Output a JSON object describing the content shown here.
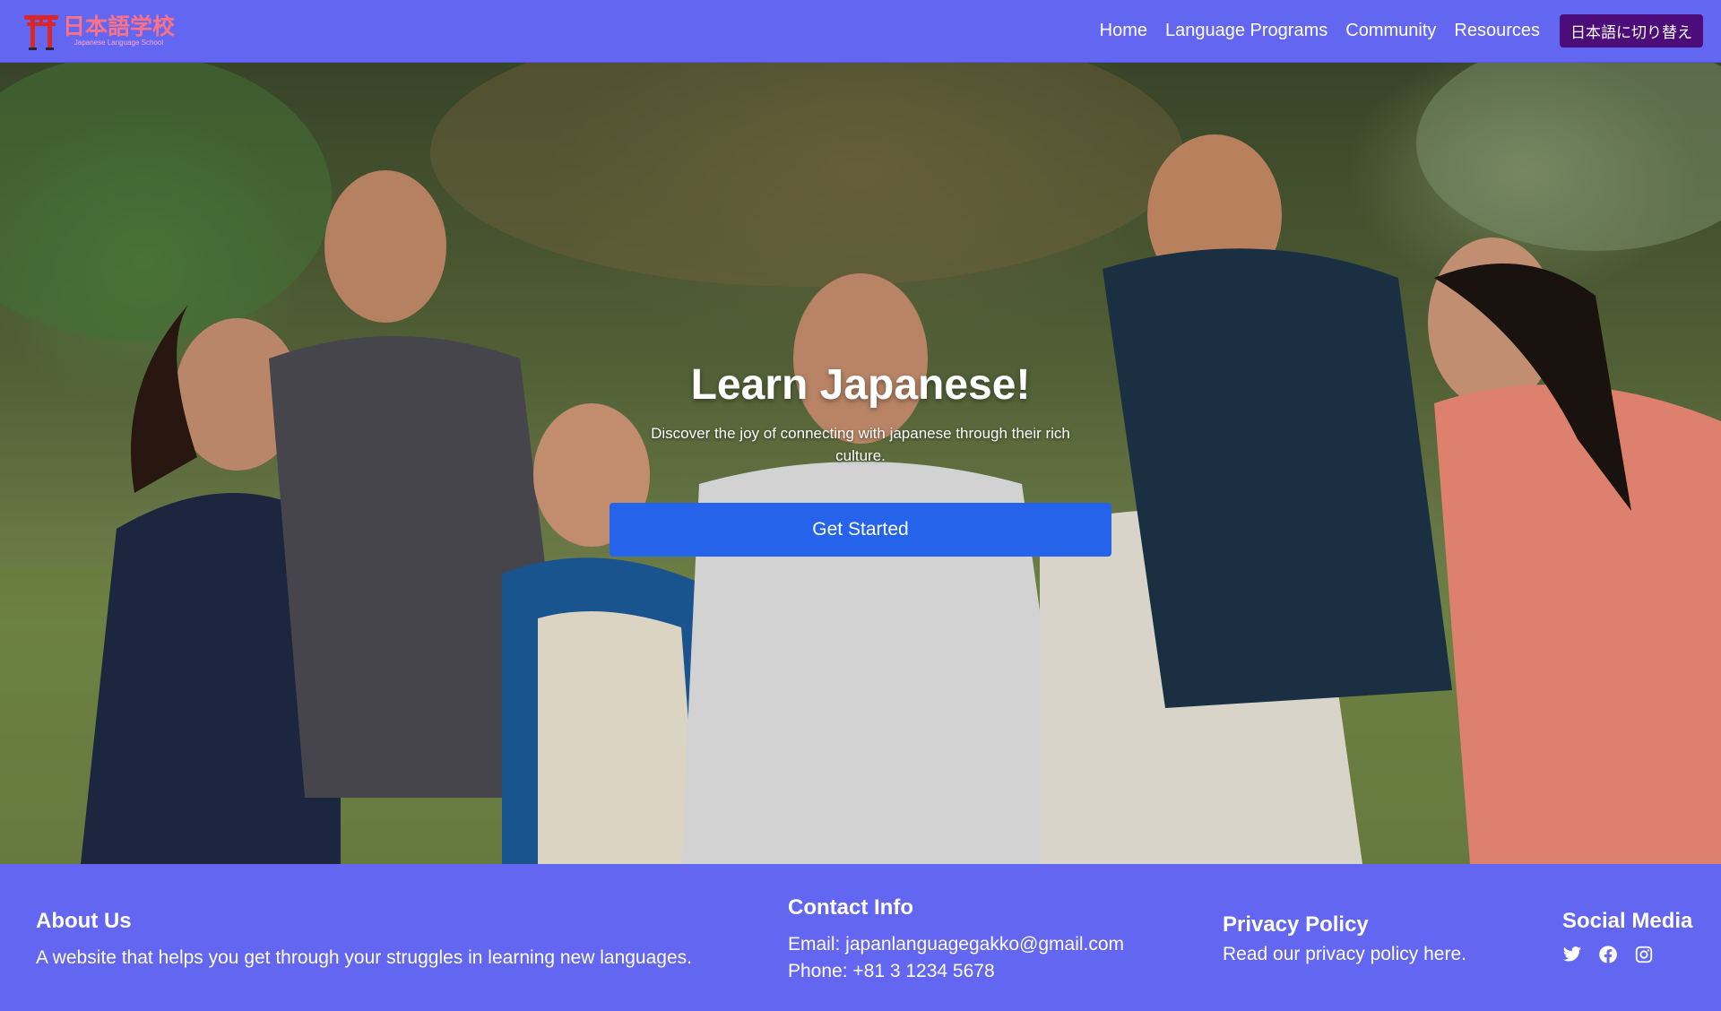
{
  "brand": {
    "title": "日本語学校",
    "subtitle": "Japanese Language School"
  },
  "nav": {
    "items": [
      "Home",
      "Language Programs",
      "Community",
      "Resources"
    ],
    "language_toggle": "日本語に切り替え"
  },
  "hero": {
    "title": "Learn Japanese!",
    "subtitle": "Discover the joy of connecting with japanese through their rich culture.",
    "cta_label": "Get Started"
  },
  "footer": {
    "about": {
      "heading": "About Us",
      "text": "A website that helps you get through your struggles in learning new languages."
    },
    "contact": {
      "heading": "Contact Info",
      "email": "Email: japanlanguagegakko@gmail.com",
      "phone": "Phone: +81 3 1234 5678"
    },
    "privacy": {
      "heading": "Privacy Policy",
      "text": "Read our privacy policy here."
    },
    "social": {
      "heading": "Social Media",
      "icons": [
        "twitter-icon",
        "facebook-icon",
        "instagram-icon"
      ]
    }
  },
  "colors": {
    "primary": "#6366f1",
    "cta": "#2563eb",
    "brand_text": "#fb7185",
    "torii": "#dc2626",
    "lang_button": "#4c0d7a"
  }
}
